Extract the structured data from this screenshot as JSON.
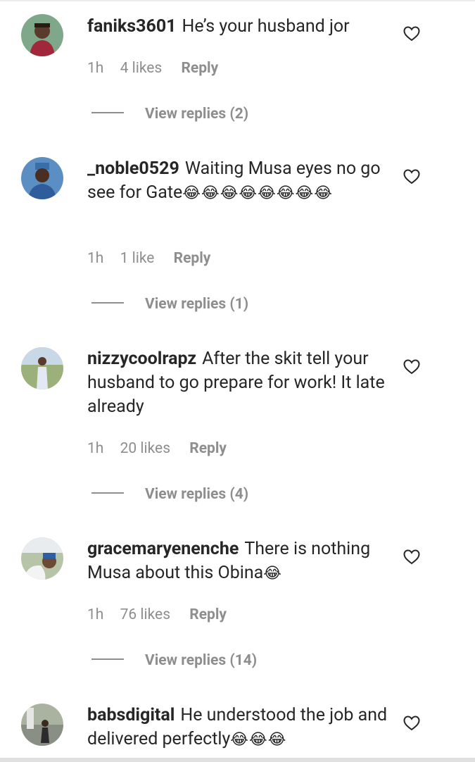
{
  "comments": [
    {
      "username": "faniks3601",
      "text": "He’s your husband jor",
      "emoji": "",
      "time": "1h",
      "likes": "4 likes",
      "reply": "Reply",
      "view_replies": "View replies (2)"
    },
    {
      "username": "_noble0529",
      "text": "Waiting Musa eyes no go see for Gate",
      "emoji": "😂😂😂😂😂😂😂😂",
      "time": "1h",
      "likes": "1 like",
      "reply": "Reply",
      "view_replies": "View replies (1)"
    },
    {
      "username": "nizzycoolrapz",
      "text": "After the skit tell your husband to go prepare for work! It late already",
      "emoji": "",
      "time": "1h",
      "likes": "20 likes",
      "reply": "Reply",
      "view_replies": "View replies (4)"
    },
    {
      "username": "gracemaryenenche",
      "text": "There is nothing Musa about this Obina",
      "emoji": "😂",
      "time": "1h",
      "likes": "76 likes",
      "reply": "Reply",
      "view_replies": "View replies (14)"
    },
    {
      "username": "babsdigital",
      "text": "He understood the job and delivered perfectly",
      "emoji": "😂😂😂",
      "time": "",
      "likes": "",
      "reply": "",
      "view_replies": ""
    }
  ],
  "icons": {
    "heart": "heart-outline-icon"
  },
  "colors": {
    "text": "#262626",
    "muted": "#8e8e8e"
  }
}
